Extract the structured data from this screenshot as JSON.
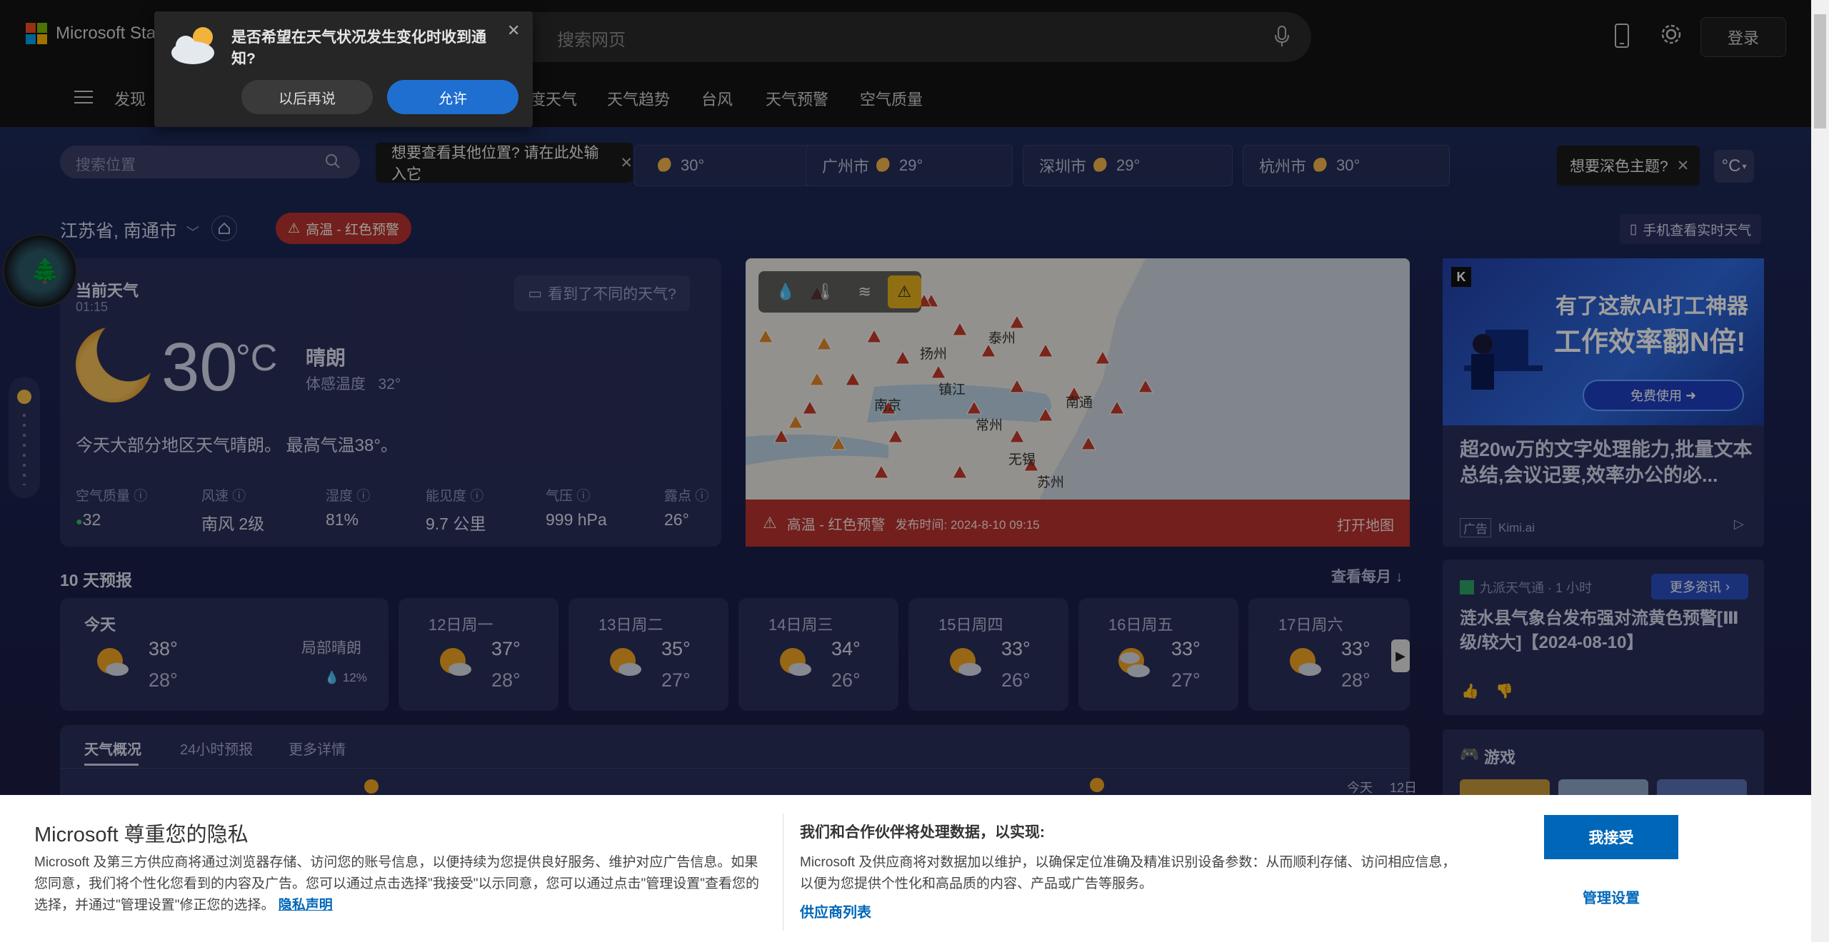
{
  "header": {
    "brand": "Microsoft Sta",
    "search_placeholder": "搜索网页",
    "login": "登录",
    "nav_menu": "发现",
    "nav_items": [
      "度天气",
      "天气趋势",
      "台风",
      "天气预警",
      "空气质量"
    ]
  },
  "notification": {
    "title": "是否希望在天气状况发生变化时收到通知?",
    "later": "以后再说",
    "allow": "允许"
  },
  "location_bar": {
    "placeholder": "搜索位置",
    "tooltip": "想要查看其他位置? 请在此处输入它",
    "cities": [
      {
        "name": "",
        "temp": "30°"
      },
      {
        "name": "广州市",
        "temp": "29°"
      },
      {
        "name": "深圳市",
        "temp": "29°"
      },
      {
        "name": "杭州市",
        "temp": "30°"
      }
    ],
    "theme_tip": "想要深色主题?",
    "unit": "°C"
  },
  "region": {
    "name": "江苏省, 南通市",
    "alert": "高温 - 红色预警",
    "mobile_link": "手机查看实时天气"
  },
  "current": {
    "title": "当前天气",
    "time": "01:15",
    "feedback": "看到了不同的天气?",
    "temp": "30",
    "unit": "°C",
    "condition": "晴朗",
    "feels_label": "体感温度",
    "feels_value": "32°",
    "summary": "今天大部分地区天气晴朗。 最高气温38°。",
    "stats": [
      {
        "k": "空气质量",
        "v": "32"
      },
      {
        "k": "风速",
        "v": "南风 2级"
      },
      {
        "k": "湿度",
        "v": "81%"
      },
      {
        "k": "能见度",
        "v": "9.7 公里"
      },
      {
        "k": "气压",
        "v": "999 hPa"
      },
      {
        "k": "露点",
        "v": "26°"
      }
    ]
  },
  "map": {
    "cities": [
      "泰州",
      "扬州",
      "镇江",
      "南京",
      "南通",
      "常州",
      "无锡",
      "苏州"
    ],
    "alert_text": "高温 - 红色预警",
    "alert_time": "发布时间: 2024-8-10 09:15",
    "open_map": "打开地图"
  },
  "forecast": {
    "title": "10 天预报",
    "monthly": "查看每月",
    "today": {
      "label": "今天",
      "hi": "38°",
      "lo": "28°",
      "cond": "局部晴朗",
      "precip": "12%"
    },
    "days": [
      {
        "label": "12日周一",
        "hi": "37°",
        "lo": "28°"
      },
      {
        "label": "13日周二",
        "hi": "35°",
        "lo": "27°"
      },
      {
        "label": "14日周三",
        "hi": "34°",
        "lo": "26°"
      },
      {
        "label": "15日周四",
        "hi": "33°",
        "lo": "26°"
      },
      {
        "label": "16日周五",
        "hi": "33°",
        "lo": "27°"
      },
      {
        "label": "17日周六",
        "hi": "33°",
        "lo": "28°"
      }
    ]
  },
  "tabs": [
    "天气概况",
    "24小时预报",
    "更多详情"
  ],
  "tabs_extra": {
    "today": "今天",
    "next": "12日"
  },
  "ad": {
    "headline1": "有了这款AI打工神器",
    "headline2": "工作效率翻N倍!",
    "cta": "免费使用",
    "title": "超20w万的文字处理能力,批量文本总结,会议记要,效率办公的必...",
    "tag": "广告",
    "advertiser": "Kimi.ai"
  },
  "news": {
    "source": "九派天气通 · 1 小时",
    "more": "更多资讯",
    "title": "涟水县气象台发布强对流黄色预警[Ⅲ级/较大]【2024-08-10】"
  },
  "games": {
    "title": "游戏"
  },
  "privacy": {
    "title": "Microsoft 尊重您的隐私",
    "body": "Microsoft 及第三方供应商将通过浏览器存储、访问您的账号信息，以便持续为您提供良好服务、维护对应广告信息。如果您同意，我们将个性化您看到的内容及广告。您可以通过点击选择\"我接受\"以示同意，您可以通过点击\"管理设置\"查看您的选择，并通过\"管理设置\"修正您的选择。",
    "link": "隐私声明",
    "h2": "我们和合作伙伴将处理数据，以实现:",
    "body2": "Microsoft 及供应商将对数据加以维护，以确保定位准确及精准识别设备参数：从而顺利存储、访问相应信息，以便为您提供个性化和高品质的内容、产品或广告等服务。",
    "vendors": "供应商列表",
    "accept": "我接受",
    "manage": "管理设置"
  }
}
